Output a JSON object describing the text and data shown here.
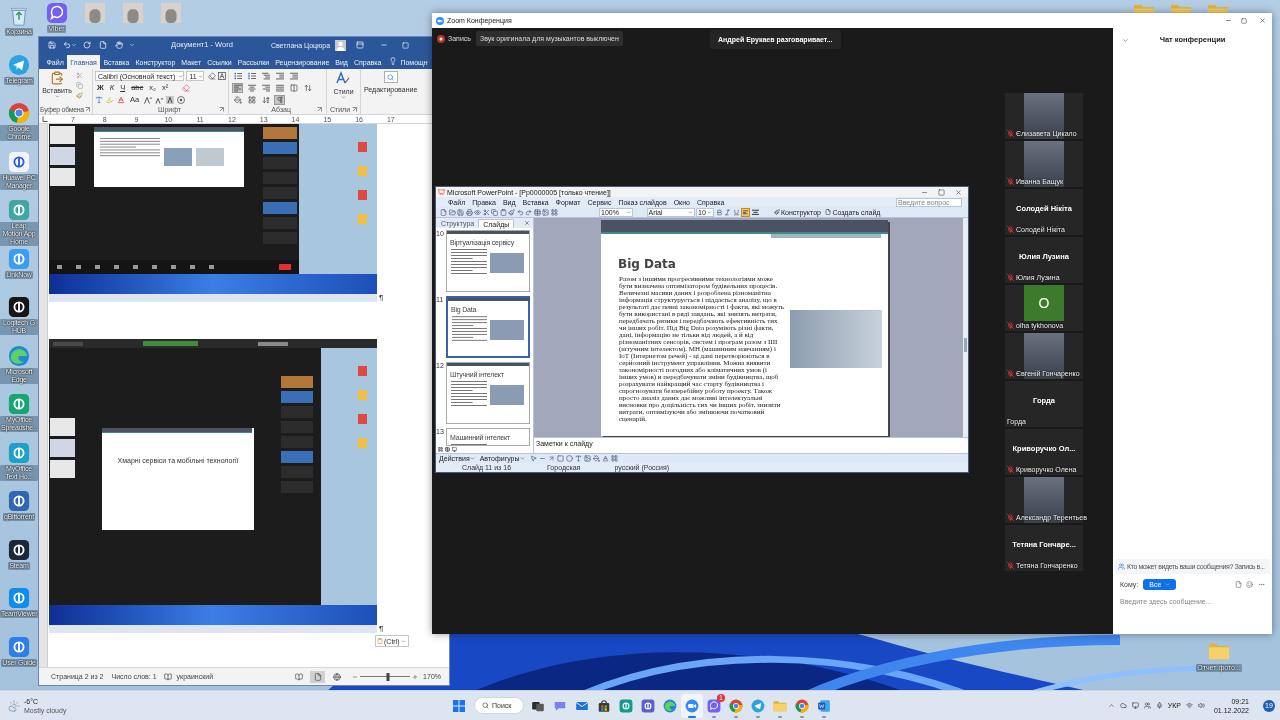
{
  "desktop": {
    "left_icons": [
      {
        "label": "Корзина",
        "kind": "recycle"
      },
      {
        "label": "Telegram",
        "kind": "telegram"
      },
      {
        "label": "Google Chrome",
        "kind": "chrome"
      },
      {
        "label": "Huawei PC Manager",
        "kind": "pcmanager"
      },
      {
        "label": "Leap Motion App Home",
        "kind": "leap"
      },
      {
        "label": "LinkNow",
        "kind": "linknow"
      },
      {
        "label": "Logitech G HUB",
        "kind": "logitech"
      },
      {
        "label": "Microsoft Edge",
        "kind": "edge"
      },
      {
        "label": "MyOffice Spreadshe...",
        "kind": "sheet"
      },
      {
        "label": "MyOffice Text Ho...",
        "kind": "text"
      },
      {
        "label": "qBittorrent",
        "kind": "qbit"
      },
      {
        "label": "Steam",
        "kind": "steam"
      },
      {
        "label": "TeamViewer",
        "kind": "teamviewer"
      },
      {
        "label": "User Guide",
        "kind": "guide"
      }
    ],
    "top_icons": [
      {
        "kind": "viber",
        "label": "Viber"
      },
      {
        "kind": "photo"
      },
      {
        "kind": "photo"
      },
      {
        "kind": "photo"
      }
    ],
    "edge_folders": [
      {
        "kind": "folder"
      },
      {
        "kind": "folder"
      },
      {
        "kind": "folder"
      }
    ],
    "right_icons": [
      {
        "kind": "folder",
        "label": "Отчет фото..."
      }
    ]
  },
  "word": {
    "title": "Документ1 - Word",
    "user": "Светлана Цоцюра",
    "tabs": [
      {
        "label": "Файл",
        "selected": false
      },
      {
        "label": "Главная",
        "selected": true
      },
      {
        "label": "Вставка",
        "selected": false
      },
      {
        "label": "Конструктор",
        "selected": false
      },
      {
        "label": "Макет",
        "selected": false
      },
      {
        "label": "Ссылки",
        "selected": false
      },
      {
        "label": "Рассылки",
        "selected": false
      },
      {
        "label": "Рецензирование",
        "selected": false
      },
      {
        "label": "Вид",
        "selected": false
      },
      {
        "label": "Справка",
        "selected": false
      },
      {
        "label": "Помощн",
        "selected": false
      }
    ],
    "ribbon": {
      "paste": "Вставить",
      "font_name": "Calibri (Основной текст)",
      "font_size": "11",
      "format_buttons": [
        "Ж",
        "К",
        "Ч",
        "abc",
        "x₂",
        "x²"
      ],
      "case_button": "Аа",
      "paragraph_tools": [
        {
          "kind": "bullets",
          "selected": false
        },
        {
          "kind": "numbering",
          "selected": false
        },
        {
          "kind": "multilevel",
          "selected": false
        },
        {
          "kind": "outdent",
          "selected": false
        },
        {
          "kind": "indent",
          "selected": false
        },
        {
          "kind": "left",
          "selected": true
        },
        {
          "kind": "center",
          "selected": false
        },
        {
          "kind": "right",
          "selected": false
        },
        {
          "kind": "justify",
          "selected": false
        },
        {
          "kind": "columns",
          "selected": false
        },
        {
          "kind": "spacing",
          "selected": false
        },
        {
          "kind": "shading",
          "selected": false
        },
        {
          "kind": "borders",
          "selected": false
        },
        {
          "kind": "sort",
          "selected": false
        },
        {
          "kind": "marks",
          "selected": true
        }
      ],
      "styles": "Стили",
      "editing": "Редактирование",
      "group_labels": [
        "Буфер обмена",
        "Шрифт",
        "Абзац",
        "Стили"
      ]
    },
    "ruler": [
      "7",
      "8",
      "9",
      "10",
      "11",
      "12",
      "13",
      "14",
      "15",
      "16",
      "17"
    ],
    "document": {
      "screenshots": [
        {
          "kind": "content",
          "mark": "¶"
        },
        {
          "kind": "title",
          "slide_title": "Хмарні сервіси та мобільні технології",
          "mark": "¶"
        }
      ],
      "paste_options": "(Ctrl)"
    },
    "status": {
      "page": "Страница 2 из 2",
      "words": "Число слов: 1",
      "language": "украинский",
      "views": [
        {
          "kind": "read",
          "selected": false
        },
        {
          "kind": "print",
          "selected": true
        },
        {
          "kind": "web",
          "selected": false
        }
      ],
      "zoom_slider": {
        "level": 0.55
      },
      "zoom": "170%"
    }
  },
  "zoom": {
    "title": "Zoom Конференция",
    "recording": "Запись",
    "audio_notice": "Звук оригинала для музыкантов выключен",
    "speaker": "Андрей Ерукаев разговаривает...",
    "shared_screen": {
      "title": "Microsoft PowerPoint - [Pp0000005 [только чтение]]",
      "menu": [
        "Файл",
        "Правка",
        "Вид",
        "Вставка",
        "Формат",
        "Сервис",
        "Показ слайдов",
        "Окно",
        "Справка"
      ],
      "help_placeholder": "Введите вопрос",
      "zoom": "100%",
      "font": "Arial",
      "size": "10",
      "design": "Конструктор",
      "new_slide": "Создать слайд",
      "pane_tabs": [
        {
          "label": "Структура",
          "selected": false
        },
        {
          "label": "Слайды",
          "selected": true
        }
      ],
      "thumbnails": [
        {
          "number": "10",
          "title": "Віртуалізація сервісу",
          "kind": "photo",
          "selected": false
        },
        {
          "number": "11",
          "title": "Big Data",
          "kind": "photo",
          "selected": true
        },
        {
          "number": "12",
          "title": "Штучний інтелект",
          "kind": "photo",
          "selected": false
        },
        {
          "number": "13",
          "title": "Машинний інтелект",
          "kind": "text",
          "selected": false
        }
      ],
      "slide": {
        "title": "Big Data",
        "body": "Разом з іншими прогресивними технологіями може бути визначена оптимізатором будівельних процесів. Величезні масиви даних і розроблена різноманітна інформація структурується і піддається аналізу, що в результаті дає певні закономірності і факти, які можуть бути використані в ряді завдань, які знизять витрати, передбачать ризики і передбачають ефективність тих чи інших робіт. Під Big Data розуміють різні факти, дані, інформацію не тільки від людей, а й від різноманітних сенсорів, систем і програм разом з ШІ (штучним інтелектом), МН (машинним навчанням) і IoT (Інтернетом речей) - ці дані перетворюються в серйозний інструмент управління. Можна виявити закономірності погодних або кліматичних умов (і інших умов) и передбачувати зміни будівництва, щоб розрахувати найкращий час старту будівництва і спрогнозувати безперебійну роботу проекту. Також просто аналіз даних дає можливі інтелектуальні висновки про доцільність тих чи інших робіт, знизити витрати, оптимізуючи або змінюючи початковий сценарій."
      },
      "notes_placeholder": "Заметки к слайду",
      "draw_toolbar": [
        "Действия",
        "Автофигуры"
      ],
      "status": [
        "Слайд 11 из 16",
        "Городская",
        "русский (Россия)"
      ]
    },
    "participants": [
      {
        "kind": "video",
        "label": "Єлизавета Цикало",
        "muted": true
      },
      {
        "kind": "video",
        "label": "Иванна Бащук",
        "muted": true
      },
      {
        "kind": "name",
        "display": "Солодей Нікіта",
        "label": "Солодей Нікіта",
        "muted": true
      },
      {
        "kind": "name",
        "display": "Юлия Лузина",
        "label": "Юлия Лузина",
        "muted": true
      },
      {
        "kind": "avatar",
        "display": "O",
        "label": "olha tykhonova",
        "muted": true
      },
      {
        "kind": "video",
        "label": "Євгеній Гончаренко",
        "muted": true
      },
      {
        "kind": "name",
        "display": "Горда",
        "label": "Горда",
        "muted": false
      },
      {
        "kind": "name",
        "display": "Криворучко Ол...",
        "label": "Криворучко Олена",
        "muted": true
      },
      {
        "kind": "video",
        "label": "Александр Терентьев",
        "muted": true
      },
      {
        "kind": "name",
        "display": "Тетяна Гончаре...",
        "label": "Тетяна Гончаренко",
        "muted": true
      }
    ],
    "chat": {
      "title": "Чат конференции",
      "notice": "Кто может видеть ваши сообщения? Запись в...",
      "to_label": "Кому:",
      "recipient": "Все",
      "placeholder": "Введите здесь сообщение..."
    }
  },
  "taskbar": {
    "weather": {
      "temp": "-6°C",
      "condition": "Mostly cloudy"
    },
    "search": "Поиск",
    "apps": [
      {
        "kind": "taskview",
        "open": false,
        "selected": false
      },
      {
        "kind": "chat",
        "open": false,
        "selected": false
      },
      {
        "kind": "mail",
        "open": false,
        "selected": false
      },
      {
        "kind": "store",
        "open": false,
        "selected": false
      },
      {
        "kind": "calc",
        "open": false,
        "selected": false
      },
      {
        "kind": "teams",
        "open": false,
        "selected": false
      },
      {
        "kind": "edge",
        "open": false,
        "selected": false
      },
      {
        "kind": "zoom",
        "open": true,
        "selected": true
      },
      {
        "kind": "viber",
        "open": true,
        "selected": false,
        "badge": "1"
      },
      {
        "kind": "chrome",
        "open": true,
        "selected": false
      },
      {
        "kind": "telegram",
        "open": true,
        "selected": false
      },
      {
        "kind": "folder",
        "open": true,
        "selected": false
      },
      {
        "kind": "chrome",
        "open": true,
        "selected": false
      },
      {
        "kind": "word",
        "open": true,
        "selected": false
      }
    ],
    "language": "УКР",
    "time": "09:21",
    "date": "01.12.2022",
    "notifications": "19"
  }
}
